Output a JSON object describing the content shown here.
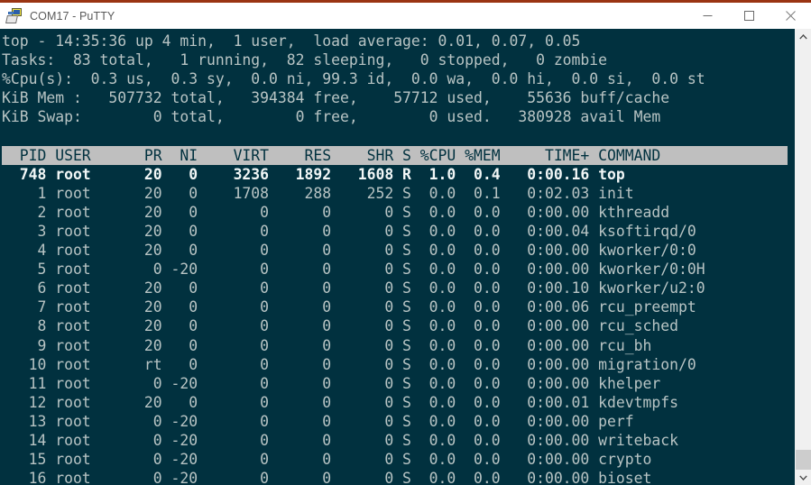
{
  "window": {
    "title": "COM17 - PuTTY",
    "icon": "putty-icon",
    "minimize_label": "Minimize",
    "maximize_label": "Maximize",
    "close_label": "Close"
  },
  "terminal": {
    "background_color": "#01313f",
    "foreground_color": "#b8c4c4",
    "bold_color": "#f2f7f7",
    "header_background_color": "#bfbfbf",
    "header_foreground_color": "#01313f",
    "summary": {
      "line1_pre": "top - ",
      "time": "14:35:36",
      "uptime_label": " up ",
      "uptime": "4 min",
      "users": "1 user",
      "load_label": "load average: ",
      "load_avg_1": "0.01",
      "load_avg_5": "0.07",
      "load_avg_15": "0.05",
      "tasks_label": "Tasks:",
      "tasks_total": "83",
      "tasks_running": "1",
      "tasks_sleeping": "82",
      "tasks_stopped": "0",
      "tasks_zombie": "0",
      "cpu_label": "%Cpu(s):",
      "cpu_us": "0.3",
      "cpu_sy": "0.3",
      "cpu_ni": "0.0",
      "cpu_id": "99.3",
      "cpu_wa": "0.0",
      "cpu_hi": "0.0",
      "cpu_si": "0.0",
      "cpu_st": "0.0",
      "mem_label": "KiB Mem :",
      "mem_total": "507732",
      "mem_free": "394384",
      "mem_used": "57712",
      "mem_buff_cache": "55636",
      "swap_label": "KiB Swap:",
      "swap_total": "0",
      "swap_free": "0",
      "swap_used": "0",
      "swap_avail": "380928"
    },
    "lines": [
      "top - 14:35:36 up 4 min,  1 user,  load average: 0.01, 0.07, 0.05",
      "Tasks:  83 total,   1 running,  82 sleeping,   0 stopped,   0 zombie",
      "%Cpu(s):  0.3 us,  0.3 sy,  0.0 ni, 99.3 id,  0.0 wa,  0.0 hi,  0.0 si,  0.0 st",
      "KiB Mem :   507732 total,   394384 free,    57712 used,    55636 buff/cache",
      "KiB Swap:        0 total,        0 free,        0 used.   380928 avail Mem",
      ""
    ],
    "columns_line": "  PID USER      PR  NI    VIRT    RES    SHR S %CPU %MEM     TIME+ COMMAND",
    "columns": [
      "PID",
      "USER",
      "PR",
      "NI",
      "VIRT",
      "RES",
      "SHR",
      "S",
      "%CPU",
      "%MEM",
      "TIME+",
      "COMMAND"
    ],
    "processes": [
      {
        "line": "  748 root      20   0    3236   1892   1608 R  1.0  0.4   0:00.16 top",
        "pid": "748",
        "user": "root",
        "pr": "20",
        "ni": "0",
        "virt": "3236",
        "res": "1892",
        "shr": "1608",
        "s": "R",
        "cpu": "1.0",
        "mem": "0.4",
        "time": "0:00.16",
        "command": "top",
        "bold": true
      },
      {
        "line": "    1 root      20   0    1708    288    252 S  0.0  0.1   0:02.03 init",
        "pid": "1",
        "user": "root",
        "pr": "20",
        "ni": "0",
        "virt": "1708",
        "res": "288",
        "shr": "252",
        "s": "S",
        "cpu": "0.0",
        "mem": "0.1",
        "time": "0:02.03",
        "command": "init",
        "bold": false
      },
      {
        "line": "    2 root      20   0       0      0      0 S  0.0  0.0   0:00.00 kthreadd",
        "pid": "2",
        "user": "root",
        "pr": "20",
        "ni": "0",
        "virt": "0",
        "res": "0",
        "shr": "0",
        "s": "S",
        "cpu": "0.0",
        "mem": "0.0",
        "time": "0:00.00",
        "command": "kthreadd",
        "bold": false
      },
      {
        "line": "    3 root      20   0       0      0      0 S  0.0  0.0   0:00.04 ksoftirqd/0",
        "pid": "3",
        "user": "root",
        "pr": "20",
        "ni": "0",
        "virt": "0",
        "res": "0",
        "shr": "0",
        "s": "S",
        "cpu": "0.0",
        "mem": "0.0",
        "time": "0:00.04",
        "command": "ksoftirqd/0",
        "bold": false
      },
      {
        "line": "    4 root      20   0       0      0      0 S  0.0  0.0   0:00.00 kworker/0:0",
        "pid": "4",
        "user": "root",
        "pr": "20",
        "ni": "0",
        "virt": "0",
        "res": "0",
        "shr": "0",
        "s": "S",
        "cpu": "0.0",
        "mem": "0.0",
        "time": "0:00.00",
        "command": "kworker/0:0",
        "bold": false
      },
      {
        "line": "    5 root       0 -20       0      0      0 S  0.0  0.0   0:00.00 kworker/0:0H",
        "pid": "5",
        "user": "root",
        "pr": "0",
        "ni": "-20",
        "virt": "0",
        "res": "0",
        "shr": "0",
        "s": "S",
        "cpu": "0.0",
        "mem": "0.0",
        "time": "0:00.00",
        "command": "kworker/0:0H",
        "bold": false
      },
      {
        "line": "    6 root      20   0       0      0      0 S  0.0  0.0   0:00.10 kworker/u2:0",
        "pid": "6",
        "user": "root",
        "pr": "20",
        "ni": "0",
        "virt": "0",
        "res": "0",
        "shr": "0",
        "s": "S",
        "cpu": "0.0",
        "mem": "0.0",
        "time": "0:00.10",
        "command": "kworker/u2:0",
        "bold": false
      },
      {
        "line": "    7 root      20   0       0      0      0 S  0.0  0.0   0:00.06 rcu_preempt",
        "pid": "7",
        "user": "root",
        "pr": "20",
        "ni": "0",
        "virt": "0",
        "res": "0",
        "shr": "0",
        "s": "S",
        "cpu": "0.0",
        "mem": "0.0",
        "time": "0:00.06",
        "command": "rcu_preempt",
        "bold": false
      },
      {
        "line": "    8 root      20   0       0      0      0 S  0.0  0.0   0:00.00 rcu_sched",
        "pid": "8",
        "user": "root",
        "pr": "20",
        "ni": "0",
        "virt": "0",
        "res": "0",
        "shr": "0",
        "s": "S",
        "cpu": "0.0",
        "mem": "0.0",
        "time": "0:00.00",
        "command": "rcu_sched",
        "bold": false
      },
      {
        "line": "    9 root      20   0       0      0      0 S  0.0  0.0   0:00.00 rcu_bh",
        "pid": "9",
        "user": "root",
        "pr": "20",
        "ni": "0",
        "virt": "0",
        "res": "0",
        "shr": "0",
        "s": "S",
        "cpu": "0.0",
        "mem": "0.0",
        "time": "0:00.00",
        "command": "rcu_bh",
        "bold": false
      },
      {
        "line": "   10 root      rt   0       0      0      0 S  0.0  0.0   0:00.00 migration/0",
        "pid": "10",
        "user": "root",
        "pr": "rt",
        "ni": "0",
        "virt": "0",
        "res": "0",
        "shr": "0",
        "s": "S",
        "cpu": "0.0",
        "mem": "0.0",
        "time": "0:00.00",
        "command": "migration/0",
        "bold": false
      },
      {
        "line": "   11 root       0 -20       0      0      0 S  0.0  0.0   0:00.00 khelper",
        "pid": "11",
        "user": "root",
        "pr": "0",
        "ni": "-20",
        "virt": "0",
        "res": "0",
        "shr": "0",
        "s": "S",
        "cpu": "0.0",
        "mem": "0.0",
        "time": "0:00.00",
        "command": "khelper",
        "bold": false
      },
      {
        "line": "   12 root      20   0       0      0      0 S  0.0  0.0   0:00.01 kdevtmpfs",
        "pid": "12",
        "user": "root",
        "pr": "20",
        "ni": "0",
        "virt": "0",
        "res": "0",
        "shr": "0",
        "s": "S",
        "cpu": "0.0",
        "mem": "0.0",
        "time": "0:00.01",
        "command": "kdevtmpfs",
        "bold": false
      },
      {
        "line": "   13 root       0 -20       0      0      0 S  0.0  0.0   0:00.00 perf",
        "pid": "13",
        "user": "root",
        "pr": "0",
        "ni": "-20",
        "virt": "0",
        "res": "0",
        "shr": "0",
        "s": "S",
        "cpu": "0.0",
        "mem": "0.0",
        "time": "0:00.00",
        "command": "perf",
        "bold": false
      },
      {
        "line": "   14 root       0 -20       0      0      0 S  0.0  0.0   0:00.00 writeback",
        "pid": "14",
        "user": "root",
        "pr": "0",
        "ni": "-20",
        "virt": "0",
        "res": "0",
        "shr": "0",
        "s": "S",
        "cpu": "0.0",
        "mem": "0.0",
        "time": "0:00.00",
        "command": "writeback",
        "bold": false
      },
      {
        "line": "   15 root       0 -20       0      0      0 S  0.0  0.0   0:00.00 crypto",
        "pid": "15",
        "user": "root",
        "pr": "0",
        "ni": "-20",
        "virt": "0",
        "res": "0",
        "shr": "0",
        "s": "S",
        "cpu": "0.0",
        "mem": "0.0",
        "time": "0:00.00",
        "command": "crypto",
        "bold": false
      },
      {
        "line": "   16 root       0 -20       0      0      0 S  0.0  0.0   0:00.00 bioset",
        "pid": "16",
        "user": "root",
        "pr": "0",
        "ni": "-20",
        "virt": "0",
        "res": "0",
        "shr": "0",
        "s": "S",
        "cpu": "0.0",
        "mem": "0.0",
        "time": "0:00.00",
        "command": "bioset",
        "bold": false
      }
    ]
  },
  "scrollbar": {
    "up_arrow": "scroll-up-icon",
    "down_arrow": "scroll-down-icon"
  }
}
